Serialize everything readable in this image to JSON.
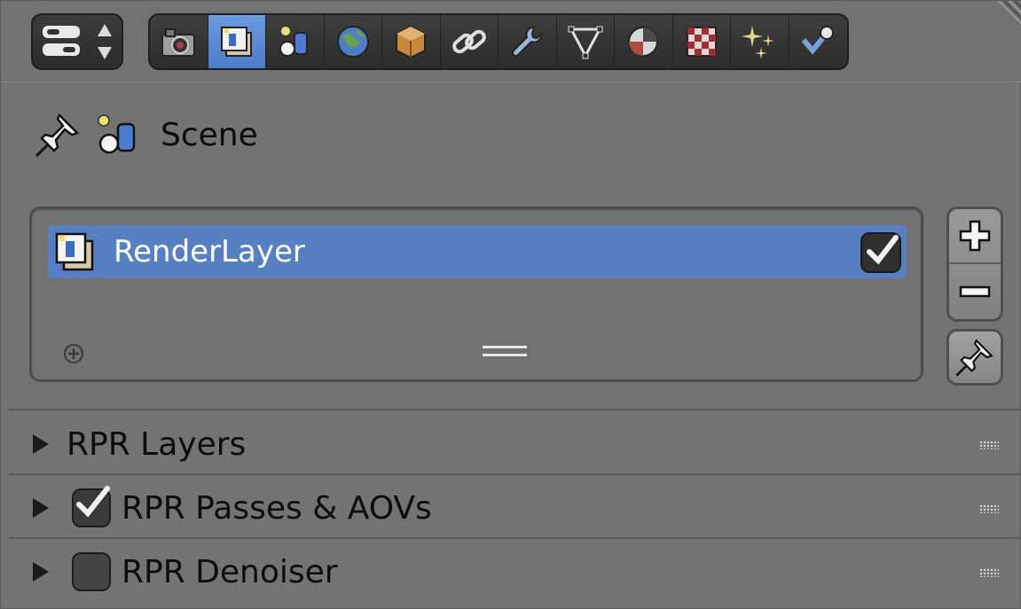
{
  "header": {
    "editor_switch_icon": "properties-editor-icon",
    "tabs": [
      {
        "icon": "render-camera-icon",
        "active": false
      },
      {
        "icon": "render-layers-icon",
        "active": true
      },
      {
        "icon": "scene-icon",
        "active": false
      },
      {
        "icon": "world-icon",
        "active": false
      },
      {
        "icon": "object-icon",
        "active": false
      },
      {
        "icon": "constraints-link-icon",
        "active": false
      },
      {
        "icon": "modifiers-wrench-icon",
        "active": false
      },
      {
        "icon": "data-mesh-icon",
        "active": false
      },
      {
        "icon": "material-icon",
        "active": false
      },
      {
        "icon": "texture-icon",
        "active": false
      },
      {
        "icon": "particles-icon",
        "active": false
      },
      {
        "icon": "physics-icon",
        "active": false
      }
    ]
  },
  "context": {
    "label": "Scene"
  },
  "layers_list": {
    "items": [
      {
        "label": "RenderLayer",
        "enabled": true,
        "selected": true
      }
    ],
    "add_label": "+",
    "remove_label": "−"
  },
  "panels": [
    {
      "title": "RPR Layers",
      "has_checkbox": false,
      "checked": false
    },
    {
      "title": "RPR Passes & AOVs",
      "has_checkbox": true,
      "checked": true
    },
    {
      "title": "RPR Denoiser",
      "has_checkbox": true,
      "checked": false
    }
  ],
  "colors": {
    "background": "#737373",
    "selection": "#5680c2",
    "active_tab": "#5b8ad4"
  }
}
